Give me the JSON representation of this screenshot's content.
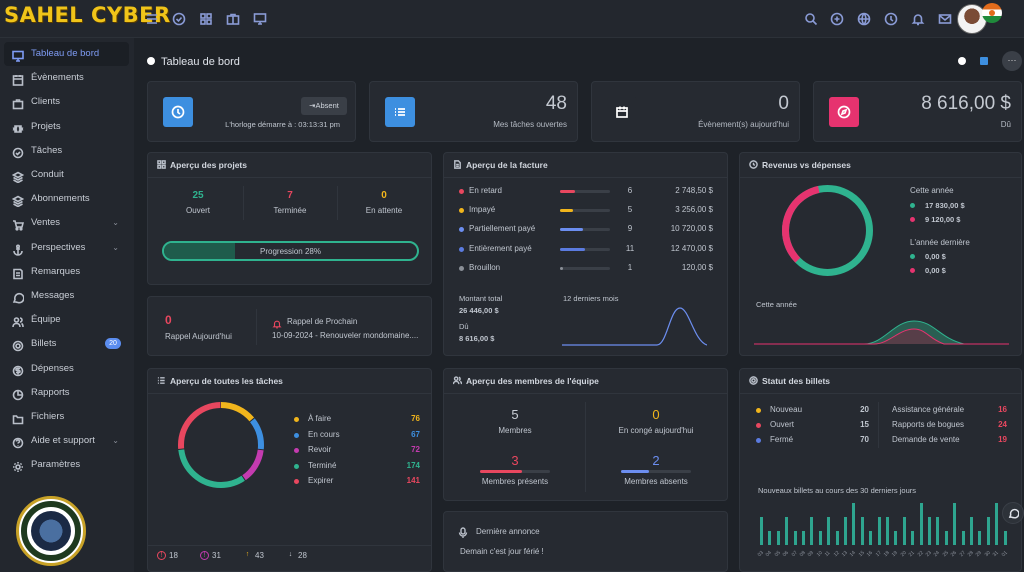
{
  "brand": "SAHEL CYBER",
  "sidebar": {
    "items": [
      {
        "label": "Tableau de bord"
      },
      {
        "label": "Évènements"
      },
      {
        "label": "Clients"
      },
      {
        "label": "Projets"
      },
      {
        "label": "Tâches"
      },
      {
        "label": "Conduit"
      },
      {
        "label": "Abonnements"
      },
      {
        "label": "Ventes"
      },
      {
        "label": "Perspectives"
      },
      {
        "label": "Remarques"
      },
      {
        "label": "Messages"
      },
      {
        "label": "Équipe"
      },
      {
        "label": "Billets",
        "badge": "20"
      },
      {
        "label": "Dépenses"
      },
      {
        "label": "Rapports"
      },
      {
        "label": "Fichiers"
      },
      {
        "label": "Aide et support"
      },
      {
        "label": "Paramètres"
      }
    ]
  },
  "logo_text": "SAHEL CYBERSECURITE",
  "page_title": "Tableau de bord",
  "clock": {
    "button": "Absent",
    "text": "L'horloge démarre à : 03:13:31 pm"
  },
  "tasks_open": {
    "value": "48",
    "label": "Mes tâches ouvertes"
  },
  "events_today": {
    "value": "0",
    "label": "Évènement(s) aujourd'hui"
  },
  "due": {
    "value": "8 616,00 $",
    "label": "Dû"
  },
  "projects": {
    "title": "Aperçu des projets",
    "stats": [
      {
        "value": "25",
        "label": "Ouvert"
      },
      {
        "value": "7",
        "label": "Terminée"
      },
      {
        "value": "0",
        "label": "En attente"
      }
    ],
    "progress_label": "Progression 28%",
    "progress": 0.28
  },
  "reminders": {
    "today_value": "0",
    "today_label": "Rappel Aujourd'hui",
    "next_title": "Rappel de Prochain",
    "next_text": "10-09-2024 - Renouveler mondomaine...."
  },
  "invoices": {
    "title": "Aperçu de la facture",
    "rows": [
      {
        "label": "En retard",
        "count": "6",
        "amount": "2 748,50 $",
        "color": "#e8475f",
        "fill": 0.3
      },
      {
        "label": "Impayé",
        "count": "5",
        "amount": "3 256,00 $",
        "color": "#f1b51c",
        "fill": 0.25
      },
      {
        "label": "Partiellement payé",
        "count": "9",
        "amount": "10 720,00 $",
        "color": "#6c8ef0",
        "fill": 0.45
      },
      {
        "label": "Entièrement payé",
        "count": "11",
        "amount": "12 470,00 $",
        "color": "#5b7be0",
        "fill": 0.5
      },
      {
        "label": "Brouillon",
        "count": "1",
        "amount": "120,00 $",
        "color": "#8a8f97",
        "fill": 0.05
      }
    ],
    "total_label": "Montant total",
    "total_value": "26 446,00 $",
    "due_label": "Dû",
    "due_value": "8 616,00 $",
    "period": "12 derniers mois"
  },
  "revenue": {
    "title": "Revenus vs dépenses",
    "this_year_label": "Cette année",
    "this_year_income": "17 830,00 $",
    "this_year_expense": "9 120,00 $",
    "last_year_label": "L'année dernière",
    "last_year_income": "0,00 $",
    "last_year_expense": "0,00 $",
    "chart_label": "Cette année"
  },
  "all_tasks": {
    "title": "Aperçu de toutes les tâches",
    "items": [
      {
        "label": "À faire",
        "value": "76",
        "color": "#f1b51c"
      },
      {
        "label": "En cours",
        "value": "67",
        "color": "#3d8fe0"
      },
      {
        "label": "Revoir",
        "value": "72",
        "color": "#c43bb0"
      },
      {
        "label": "Terminé",
        "value": "174",
        "color": "#2fb38f"
      },
      {
        "label": "Expirer",
        "value": "141",
        "color": "#e8475f"
      }
    ],
    "footer": [
      "18",
      "31",
      "43",
      "28"
    ]
  },
  "team": {
    "title": "Aperçu des membres de l'équipe",
    "members": "5",
    "members_label": "Membres",
    "leave": "0",
    "leave_label": "En congé aujourd'hui",
    "present": "3",
    "present_label": "Membres présents",
    "absent": "2",
    "absent_label": "Membres absents"
  },
  "announce": {
    "title": "Dernière annonce",
    "text": "Demain c'est jour férié !"
  },
  "tickets": {
    "title": "Statut des billets",
    "status": [
      {
        "label": "Nouveau",
        "value": "20",
        "color": "#f1b51c"
      },
      {
        "label": "Ouvert",
        "value": "15",
        "color": "#e8475f"
      },
      {
        "label": "Fermé",
        "value": "70",
        "color": "#5b7be0"
      }
    ],
    "types": [
      {
        "label": "Assistance générale",
        "value": "16"
      },
      {
        "label": "Rapports de bogues",
        "value": "24"
      },
      {
        "label": "Demande de vente",
        "value": "19"
      }
    ],
    "chart_title": "Nouveaux billets au cours des 30 derniers jours",
    "days": [
      "03",
      "04",
      "05",
      "06",
      "07",
      "08",
      "09",
      "10",
      "11",
      "12",
      "13",
      "14",
      "15",
      "16",
      "17",
      "18",
      "19",
      "20",
      "21",
      "22",
      "23",
      "24",
      "25",
      "26",
      "27",
      "28",
      "29",
      "30",
      "31",
      "01"
    ],
    "daily": [
      2,
      1,
      1,
      2,
      1,
      1,
      2,
      1,
      2,
      1,
      2,
      3,
      2,
      1,
      2,
      2,
      1,
      2,
      1,
      3,
      2,
      2,
      1,
      3,
      1,
      2,
      1,
      2,
      3,
      1
    ]
  }
}
